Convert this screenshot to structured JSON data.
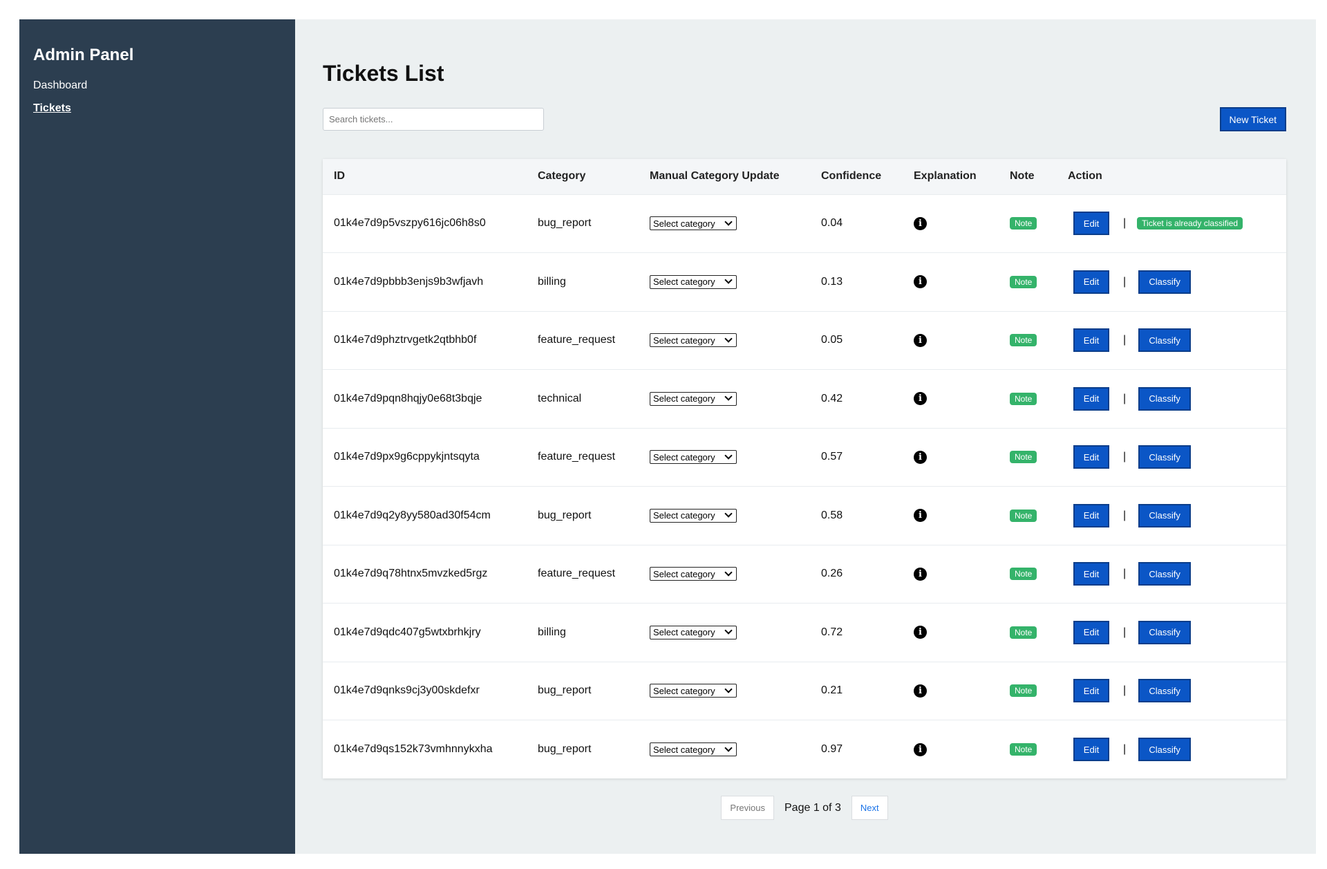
{
  "sidebar": {
    "title": "Admin Panel",
    "items": [
      {
        "label": "Dashboard",
        "active": false
      },
      {
        "label": "Tickets",
        "active": true
      }
    ]
  },
  "main": {
    "title": "Tickets List",
    "search_placeholder": "Search tickets...",
    "new_ticket_label": "New Ticket"
  },
  "table": {
    "headers": [
      "ID",
      "Category",
      "Manual Category Update",
      "Confidence",
      "Explanation",
      "Note",
      "Action"
    ],
    "select_label": "Select category",
    "note_label": "Note",
    "edit_label": "Edit",
    "separator": "|",
    "classify_label": "Classify",
    "classified_label": "Ticket is already classified",
    "rows": [
      {
        "id": "01k4e7d9p5vszpy616jc06h8s0",
        "category": "bug_report",
        "confidence": "0.04",
        "classified": true
      },
      {
        "id": "01k4e7d9pbbb3enjs9b3wfjavh",
        "category": "billing",
        "confidence": "0.13",
        "classified": false
      },
      {
        "id": "01k4e7d9phztrvgetk2qtbhb0f",
        "category": "feature_request",
        "confidence": "0.05",
        "classified": false
      },
      {
        "id": "01k4e7d9pqn8hqjy0e68t3bqje",
        "category": "technical",
        "confidence": "0.42",
        "classified": false
      },
      {
        "id": "01k4e7d9px9g6cppykjntsqyta",
        "category": "feature_request",
        "confidence": "0.57",
        "classified": false
      },
      {
        "id": "01k4e7d9q2y8yy580ad30f54cm",
        "category": "bug_report",
        "confidence": "0.58",
        "classified": false
      },
      {
        "id": "01k4e7d9q78htnx5mvzked5rgz",
        "category": "feature_request",
        "confidence": "0.26",
        "classified": false
      },
      {
        "id": "01k4e7d9qdc407g5wtxbrhkjry",
        "category": "billing",
        "confidence": "0.72",
        "classified": false
      },
      {
        "id": "01k4e7d9qnks9cj3y00skdefxr",
        "category": "bug_report",
        "confidence": "0.21",
        "classified": false
      },
      {
        "id": "01k4e7d9qs152k73vmhnnykxha",
        "category": "bug_report",
        "confidence": "0.97",
        "classified": false
      }
    ]
  },
  "pagination": {
    "previous_label": "Previous",
    "page_label": "Page 1 of 3",
    "next_label": "Next"
  },
  "colors": {
    "sidebar_bg": "#2c3e50",
    "main_bg": "#ecf0f1",
    "primary_button": "#0b56c6",
    "success_badge": "#34b36a"
  },
  "icons": {
    "explanation": "info-icon",
    "select": "chevron-down-icon"
  }
}
